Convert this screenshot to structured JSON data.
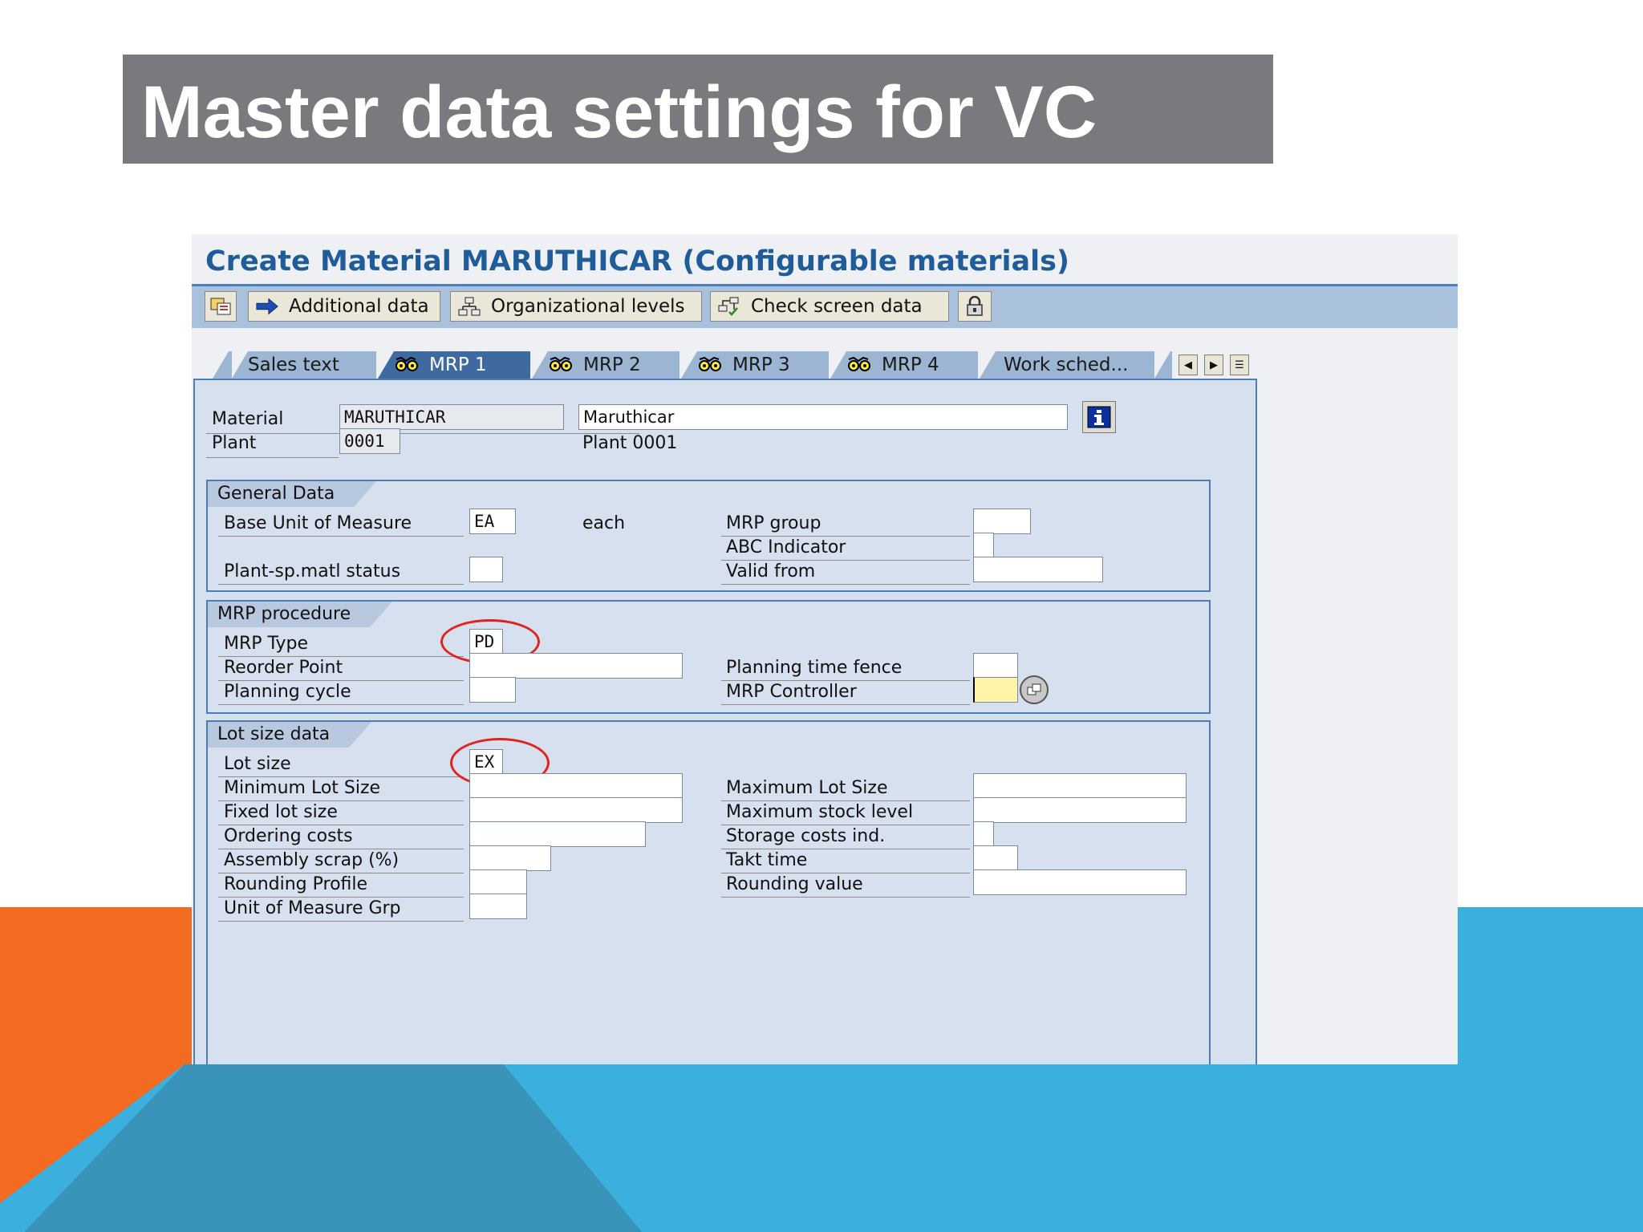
{
  "slide": {
    "title": "Master data settings for VC",
    "colors": {
      "title_bar": "#7a7a7e",
      "orange": "#f26b21",
      "blue": "#3bb0de",
      "dark_blue": "#3a93b8"
    }
  },
  "window": {
    "title": "Create Material MARUTHICAR (Configurable materials)"
  },
  "toolbar": {
    "buttons": [
      {
        "icon": "other-view-icon",
        "label": ""
      },
      {
        "icon": "arrow-right-icon",
        "label": "Additional data"
      },
      {
        "icon": "org-structure-icon",
        "label": "Organizational levels"
      },
      {
        "icon": "check-structure-icon",
        "label": "Check screen data"
      },
      {
        "icon": "lock-icon",
        "label": ""
      }
    ]
  },
  "tabs": [
    {
      "label": "Sales text",
      "icon": "",
      "active": false
    },
    {
      "label": "MRP 1",
      "icon": "glasses-icon",
      "active": true
    },
    {
      "label": "MRP 2",
      "icon": "glasses-icon",
      "active": false
    },
    {
      "label": "MRP 3",
      "icon": "glasses-icon",
      "active": false
    },
    {
      "label": "MRP 4",
      "icon": "glasses-icon",
      "active": false
    },
    {
      "label": "Work sched...",
      "icon": "",
      "active": false
    }
  ],
  "header": {
    "material_label": "Material",
    "material_value": "MARUTHICAR",
    "material_desc": "Maruthicar",
    "plant_label": "Plant",
    "plant_value": "0001",
    "plant_desc": "Plant 0001"
  },
  "general_data": {
    "title": "General Data",
    "base_uom_label": "Base Unit of Measure",
    "base_uom_value": "EA",
    "base_uom_text": "each",
    "plant_status_label": "Plant-sp.matl status",
    "plant_status_value": "",
    "mrp_group_label": "MRP group",
    "mrp_group_value": "",
    "abc_label": "ABC Indicator",
    "abc_value": "",
    "valid_from_label": "Valid from",
    "valid_from_value": ""
  },
  "mrp_procedure": {
    "title": "MRP procedure",
    "mrp_type_label": "MRP Type",
    "mrp_type_value": "PD",
    "reorder_label": "Reorder Point",
    "reorder_value": "",
    "planning_cycle_label": "Planning cycle",
    "planning_cycle_value": "",
    "ptf_label": "Planning time fence",
    "ptf_value": "",
    "controller_label": "MRP Controller",
    "controller_value": ""
  },
  "lot_size": {
    "title": "Lot size data",
    "lot_size_label": "Lot size",
    "lot_size_value": "EX",
    "min_lot_label": "Minimum Lot Size",
    "min_lot_value": "",
    "fixed_lot_label": "Fixed lot size",
    "fixed_lot_value": "",
    "ordering_costs_label": "Ordering costs",
    "ordering_costs_value": "",
    "assembly_scrap_label": "Assembly scrap (%)",
    "assembly_scrap_value": "",
    "rounding_profile_label": "Rounding Profile",
    "rounding_profile_value": "",
    "uom_group_label": "Unit of Measure Grp",
    "uom_group_value": "",
    "max_lot_label": "Maximum Lot Size",
    "max_lot_value": "",
    "max_stock_label": "Maximum stock level",
    "max_stock_value": "",
    "storage_costs_label": "Storage costs ind.",
    "storage_costs_value": "",
    "takt_label": "Takt time",
    "takt_value": "",
    "rounding_value_label": "Rounding value",
    "rounding_value_value": ""
  }
}
